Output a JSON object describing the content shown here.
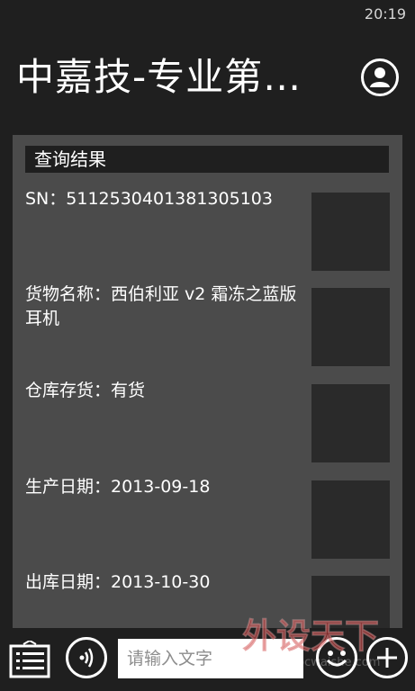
{
  "status": {
    "time": "20:19"
  },
  "header": {
    "title": "中嘉技-专业第…"
  },
  "result": {
    "heading": "查询结果",
    "rows": [
      {
        "text": "SN：5112530401381305103"
      },
      {
        "text": "货物名称：西伯利亚 v2 霜冻之蓝版 耳机"
      },
      {
        "text": "仓库存货：有货"
      },
      {
        "text": "生产日期：2013-09-18"
      },
      {
        "text": "出库日期：2013-10-30"
      }
    ]
  },
  "app_bar": {
    "input_placeholder": "请输入文字",
    "icons": {
      "menu": "menu-list-icon",
      "voice": "voice-icon",
      "emoji": "smiley-icon",
      "add": "plus-icon",
      "profile": "person-icon"
    }
  },
  "watermark": {
    "text": "外设天下",
    "url": "www.pcwaishe.com"
  }
}
